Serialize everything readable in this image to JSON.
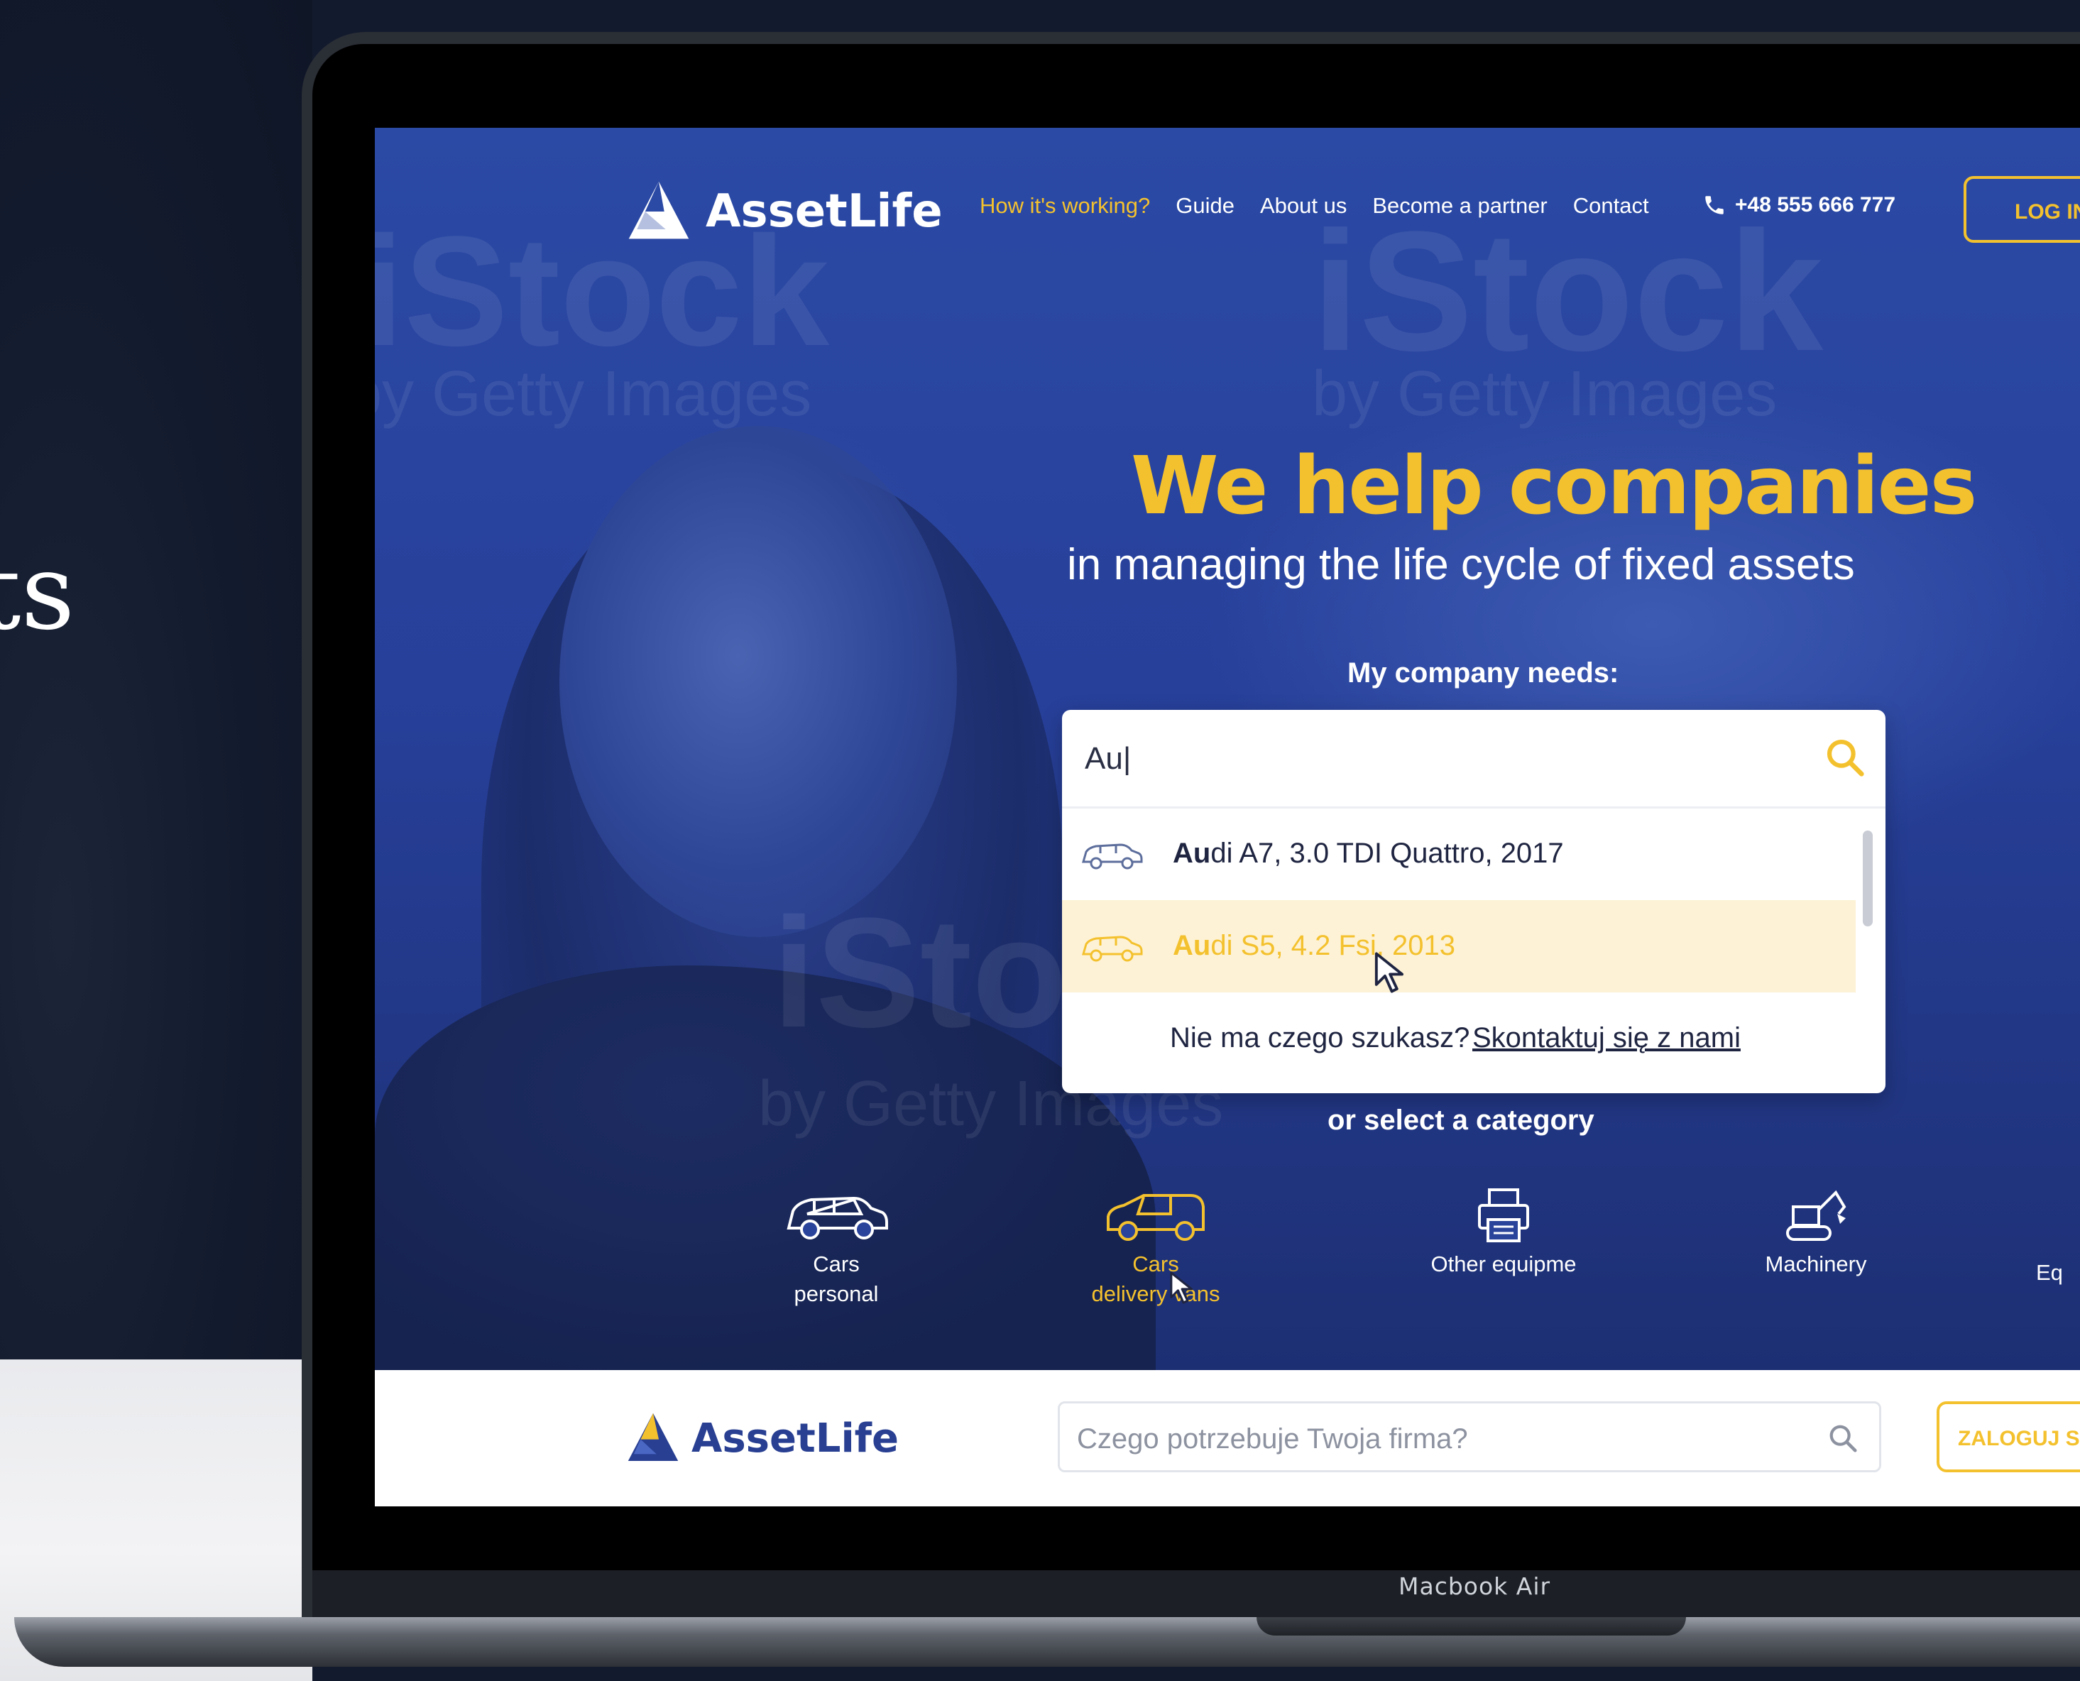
{
  "side_text": "ts",
  "device_label": "Macbook Air",
  "nav": {
    "logo_text": "AssetLife",
    "links": [
      "How it's working?",
      "Guide",
      "About us",
      "Become a partner",
      "Contact"
    ],
    "phone": "+48 555 666 777",
    "login": "LOG IN"
  },
  "watermarks": [
    "iStock",
    "by Getty Images"
  ],
  "hero": {
    "headline": "We help companies",
    "subline": "in managing the life cycle of fixed assets",
    "needs_label": "My company needs:"
  },
  "search": {
    "value": "Au|",
    "suggestions": [
      {
        "match": "Au",
        "rest": "di A7, 3.0 TDI Quattro, 2017"
      },
      {
        "match": "Au",
        "rest": "di S5, 4.2 Fsi, 2013"
      }
    ],
    "no_result_text": "Nie ma czego szukasz?",
    "contact_link": "Skontaktuj się z nami"
  },
  "or_select": "or select a category",
  "categories": [
    {
      "line1": "Cars",
      "line2": "personal",
      "icon": "car-icon"
    },
    {
      "line1": "Cars",
      "line2": "delivery vans",
      "icon": "van-icon"
    },
    {
      "line1": "Other equipme",
      "line2": "",
      "icon": "printer-icon"
    },
    {
      "line1": "Machinery",
      "line2": "",
      "icon": "excavator-icon"
    },
    {
      "line1": "Eq",
      "line2": "",
      "icon": ""
    }
  ],
  "bottom_bar": {
    "logo_text": "AssetLife",
    "search_placeholder": "Czego potrzebuje Twoja firma?",
    "login": "ZALOGUJ SIĘ"
  },
  "colors": {
    "accent": "#f4c12e",
    "brand_blue": "#283f92",
    "hero_blue": "#2b4aa5",
    "highlight_row": "#fdf2d5"
  }
}
